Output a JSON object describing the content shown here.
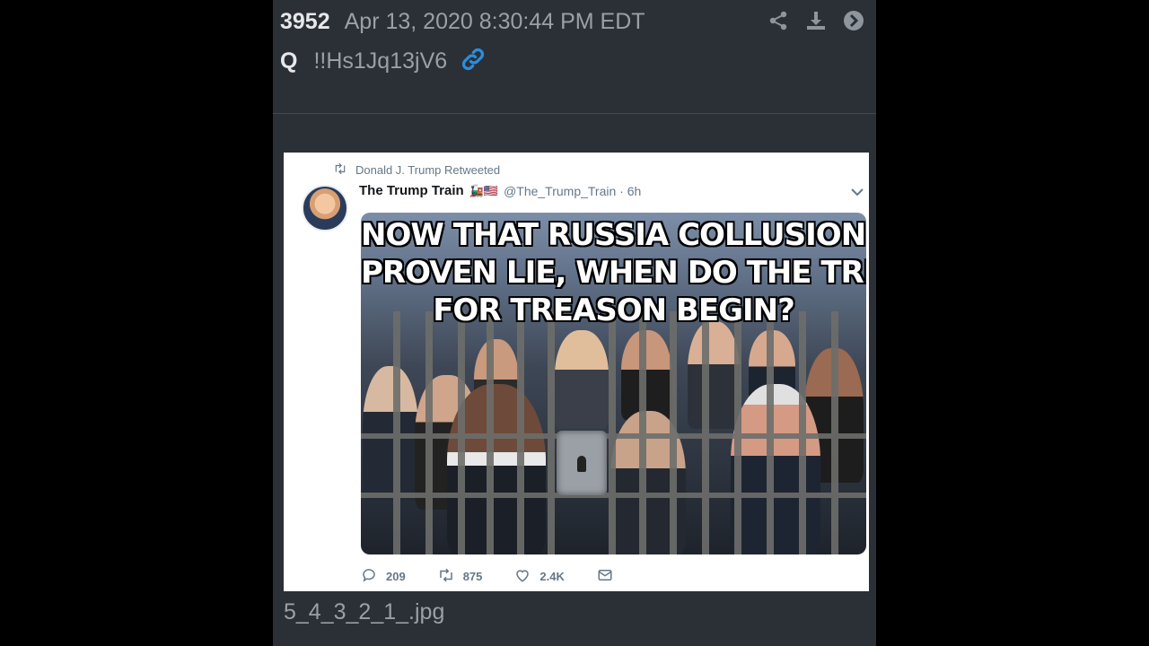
{
  "post": {
    "number": "3952",
    "date": "Apr 13, 2020 8:30:44 PM EDT",
    "author": "Q",
    "tripcode": "!!Hs1Jq13jV6",
    "icons": [
      "share-icon",
      "download-icon",
      "arrow-right-circle-icon",
      "link-icon"
    ],
    "filename": "5_4_3_2_1_.jpg"
  },
  "tweet": {
    "retweeted_by": "Donald J. Trump Retweeted",
    "author_name": "The Trump Train",
    "author_emoji": "🚂🇺🇸",
    "handle": "@The_Trump_Train · 6h",
    "meme_lines": [
      "NOW THAT RUSSIA COLLUSION IS A",
      "PROVEN LIE, WHEN DO THE TRIALS",
      "FOR TREASON BEGIN?"
    ],
    "replies": "209",
    "retweets": "875",
    "likes": "2.4K"
  },
  "colors": {
    "panel_bg": "#2b2f36",
    "link_accent": "#2a8ee0",
    "tweet_bg": "#ffffff"
  }
}
